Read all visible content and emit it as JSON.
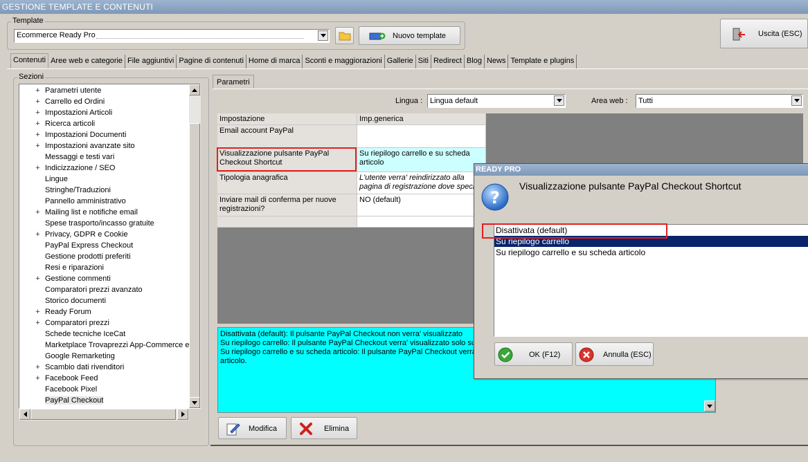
{
  "window": {
    "title": "GESTIONE TEMPLATE E CONTENUTI"
  },
  "template": {
    "group_label": "Template",
    "selected": "Ecommerce Ready Pro",
    "new_button": "Nuovo template",
    "exit_button": "Uscita (ESC)"
  },
  "tabs": [
    {
      "label": "Contenuti"
    },
    {
      "label": "Aree web e categorie"
    },
    {
      "label": "File aggiuntivi"
    },
    {
      "label": "Pagine di contenuti"
    },
    {
      "label": "Home di marca"
    },
    {
      "label": "Sconti e maggiorazioni"
    },
    {
      "label": "Gallerie"
    },
    {
      "label": "Siti"
    },
    {
      "label": "Redirect"
    },
    {
      "label": "Blog"
    },
    {
      "label": "News"
    },
    {
      "label": "Template e plugins"
    }
  ],
  "sections": {
    "label": "Sezioni",
    "items": [
      {
        "label": "Parametri utente",
        "expand": "+"
      },
      {
        "label": "Carrello ed Ordini",
        "expand": "+"
      },
      {
        "label": "Impostazioni Articoli",
        "expand": "+"
      },
      {
        "label": "Ricerca articoli",
        "expand": "+"
      },
      {
        "label": "Impostazioni Documenti",
        "expand": "+"
      },
      {
        "label": "Impostazioni avanzate sito",
        "expand": "+"
      },
      {
        "label": "Messaggi e testi vari",
        "expand": ""
      },
      {
        "label": "Indicizzazione / SEO",
        "expand": "+"
      },
      {
        "label": "Lingue",
        "expand": ""
      },
      {
        "label": "Stringhe/Traduzioni",
        "expand": ""
      },
      {
        "label": "Pannello amministrativo",
        "expand": ""
      },
      {
        "label": "Mailing list e notifiche email",
        "expand": "+"
      },
      {
        "label": "Spese trasporto/incasso gratuite",
        "expand": ""
      },
      {
        "label": "Privacy, GDPR e Cookie",
        "expand": "+"
      },
      {
        "label": "PayPal Express Checkout",
        "expand": ""
      },
      {
        "label": "Gestione prodotti preferiti",
        "expand": ""
      },
      {
        "label": "Resi e riparazioni",
        "expand": ""
      },
      {
        "label": "Gestione commenti",
        "expand": "+"
      },
      {
        "label": "Comparatori prezzi avanzato",
        "expand": ""
      },
      {
        "label": "Storico documenti",
        "expand": ""
      },
      {
        "label": "Ready Forum",
        "expand": "+"
      },
      {
        "label": "Comparatori prezzi",
        "expand": "+"
      },
      {
        "label": "Schede tecniche IceCat",
        "expand": ""
      },
      {
        "label": "Marketplace Trovaprezzi App-Commerce e Ki",
        "expand": ""
      },
      {
        "label": "Google Remarketing",
        "expand": ""
      },
      {
        "label": "Scambio dati rivenditori",
        "expand": "+"
      },
      {
        "label": "Facebook Feed",
        "expand": "+"
      },
      {
        "label": "Facebook Pixel",
        "expand": ""
      },
      {
        "label": "PayPal Checkout",
        "expand": ""
      }
    ],
    "selected_index": 28
  },
  "params": {
    "tab_label": "Parametri",
    "language_label": "Lingua :",
    "language_value": "Lingua default",
    "area_label": "Area web :",
    "area_value": "Tutti",
    "col_setting": "Impostazione",
    "col_value": "Imp.generica",
    "rows": [
      {
        "setting": "Email account PayPal",
        "value": ""
      },
      {
        "setting": "Visualizzazione pulsante PayPal Checkout Shortcut",
        "value": "Su riepilogo carrello e su scheda articolo"
      },
      {
        "setting": "Tipologia anagrafica",
        "value": "L'utente verra' reindirizzato alla pagina di registrazione dove specifi"
      },
      {
        "setting": "Inviare mail di conferma per nuove registrazioni?",
        "value": "NO (default)"
      }
    ],
    "description": [
      "Disattivata (default): Il pulsante PayPal Checkout non verra' visualizzato",
      "Su riepilogo carrello: Il pulsante PayPal Checkout verra' visualizzato solo sulla",
      "Su riepilogo carrello e su scheda articolo: Il pulsante PayPal Checkout verra' v",
      "articolo."
    ],
    "modify_button": "Modifica",
    "delete_button": "Elimina"
  },
  "dialog": {
    "title": "READY PRO",
    "question": "Visualizzazione pulsante PayPal Checkout Shortcut",
    "options": [
      {
        "label": "Disattivata (default)"
      },
      {
        "label": "Su riepilogo carrello"
      },
      {
        "label": "Su riepilogo carrello e su scheda articolo"
      }
    ],
    "selected_index": 1,
    "ok_button": "OK (F12)",
    "cancel_button": "Annulla (ESC)"
  },
  "colors": {
    "titlebar": "#8aa4c4",
    "selection": "#0a246a",
    "description_bg": "#00ffff",
    "highlight_red": "#e02020"
  }
}
